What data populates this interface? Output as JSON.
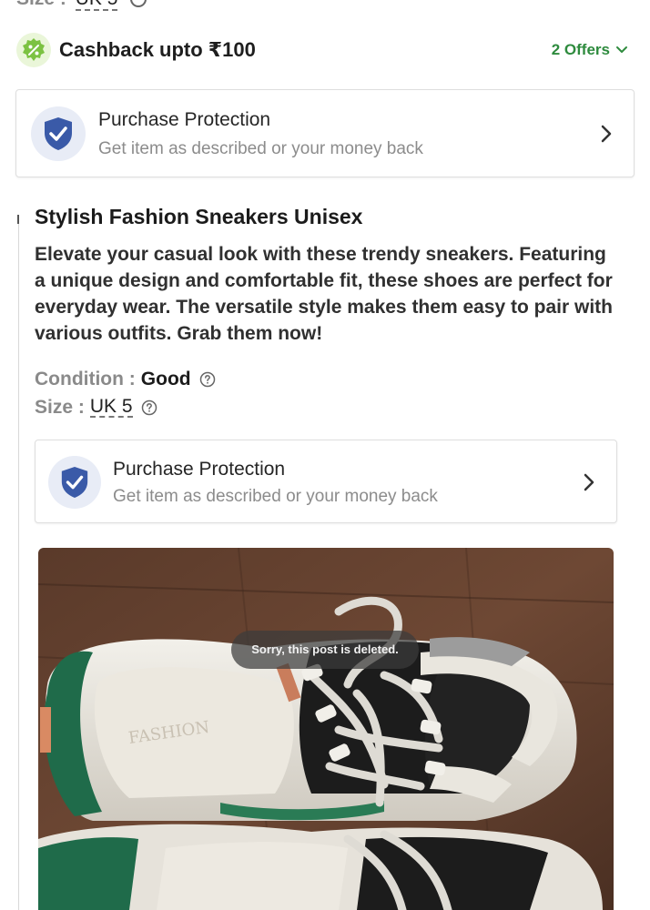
{
  "top_partial": {
    "size_label": "Size :",
    "size_value": "UK 5"
  },
  "cashback": {
    "title": "Cashback upto ₹100",
    "offers_label": "2 Offers",
    "icon": "percent-badge-icon",
    "accent_color": "#2e8b3e"
  },
  "purchase_protection": {
    "title": "Purchase Protection",
    "subtitle": "Get item as described or your money back",
    "icon": "shield-check-icon",
    "icon_color": "#3a5aa8"
  },
  "product": {
    "title": "Stylish Fashion Sneakers Unisex",
    "description": "Elevate your casual look with these trendy sneakers. Featuring a unique design and comfortable fit, these shoes are perfect for everyday wear. The versatile style makes them easy to pair with various outfits. Grab them now!",
    "condition_label": "Condition :",
    "condition_value": "Good",
    "size_label": "Size :",
    "size_value": "UK 5"
  },
  "image": {
    "overlay_text": "Sorry, this post is deleted.",
    "alt": "white-green-black-sneakers-photo"
  }
}
